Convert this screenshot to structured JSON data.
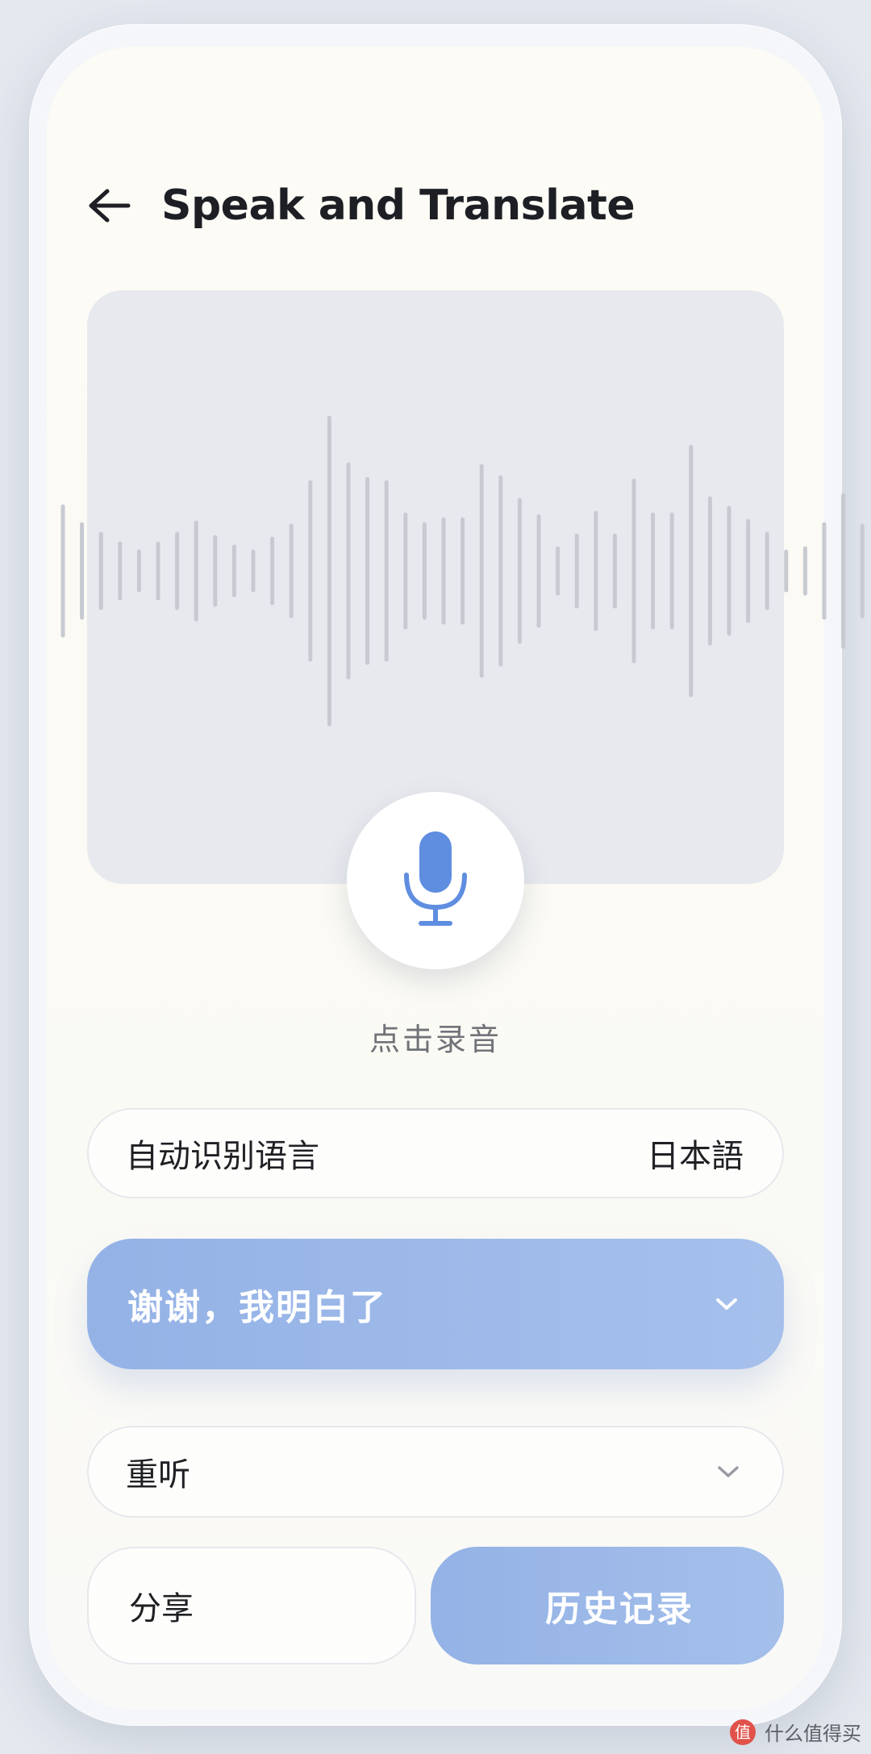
{
  "header": {
    "back_icon": "arrow-left-icon",
    "title": "Speak and Translate"
  },
  "waveform": {
    "bar_color": "#c7cad1"
  },
  "recorder": {
    "mic_icon": "microphone-icon",
    "mic_color": "#5f8ee0",
    "caption": "点击录音"
  },
  "language": {
    "source": "自动识别语言",
    "target": "日本語"
  },
  "result": {
    "text": "谢谢，我明白了",
    "chevron_icon": "chevron-down-icon"
  },
  "replay": {
    "label": "重听",
    "chevron_icon": "chevron-down-icon"
  },
  "actions": {
    "share_label": "分享",
    "history_label": "历史记录"
  },
  "watermark": {
    "text": "什么值得买",
    "logo_text": "值"
  },
  "colors": {
    "accent": "#94b2e6",
    "title_text": "#1e1f24"
  }
}
